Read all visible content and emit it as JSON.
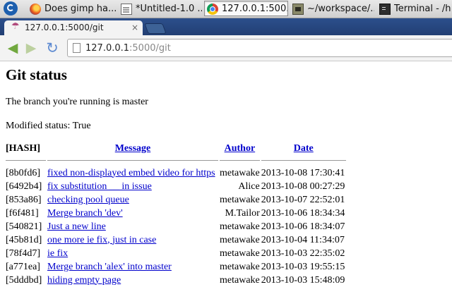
{
  "taskbar": {
    "items": [
      {
        "label": "Does gimp ha...",
        "icon": "firefox-icon"
      },
      {
        "label": "*Untitled-1.0 ...",
        "icon": "document-icon"
      },
      {
        "label": "127.0.0.1:500...",
        "icon": "chrome-icon",
        "active": true
      },
      {
        "label": "~/workspace/...",
        "icon": "folder-icon"
      },
      {
        "label": "Terminal - /ho",
        "icon": "terminal-icon"
      }
    ]
  },
  "browser": {
    "tab_title": "127.0.0.1:5000/git",
    "close_glyph": "×",
    "url_host": "127.0.0.1",
    "url_rest": ":5000/git"
  },
  "page": {
    "title": "Git status",
    "branch_text": "The branch you're running is master",
    "modified_text": "Modified status: True",
    "table": {
      "headers": {
        "hash": "[HASH]",
        "message": "Message",
        "author": "Author",
        "date": "Date"
      },
      "rows": [
        {
          "hash": "[8b0fd6]",
          "message": "fixed non-displayed embed video for https",
          "author": "metawake",
          "date": "2013-10-08 17:30:41"
        },
        {
          "hash": "[6492b4]",
          "message": "fix substitution __ in issue",
          "author": "Alice",
          "date": "2013-10-08 00:27:29"
        },
        {
          "hash": "[853a86]",
          "message": "checking pool queue",
          "author": "metawake",
          "date": "2013-10-07 22:52:01"
        },
        {
          "hash": "[f6f481]",
          "message": "Merge branch 'dev'",
          "author": "M.Tailor",
          "date": "2013-10-06 18:34:34"
        },
        {
          "hash": "[540821]",
          "message": "Just a new line",
          "author": "metawake",
          "date": "2013-10-06 18:34:07"
        },
        {
          "hash": "[45b81d]",
          "message": "one more ie fix, just in case",
          "author": "metawake",
          "date": "2013-10-04 11:34:07"
        },
        {
          "hash": "[78f4d7]",
          "message": "ie fix",
          "author": "metawake",
          "date": "2013-10-03 22:35:02"
        },
        {
          "hash": "[a771ea]",
          "message": "Merge branch 'alex' into master",
          "author": "metawake",
          "date": "2013-10-03 19:55:15"
        },
        {
          "hash": "[5dddbd]",
          "message": "hiding empty page",
          "author": "metawake",
          "date": "2013-10-03 15:48:09"
        }
      ]
    }
  },
  "colors": {
    "link": "#0000cc",
    "tabstrip": "#2c4f8c"
  }
}
